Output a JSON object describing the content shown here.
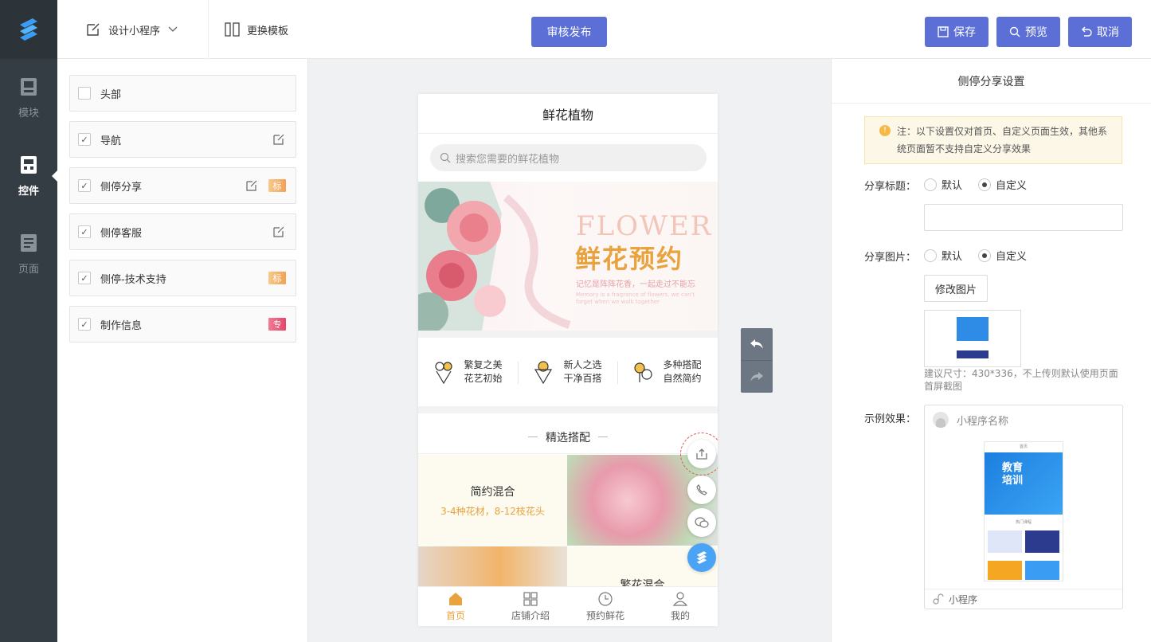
{
  "rail": {
    "items": [
      {
        "label": "模块",
        "icon": "module-icon"
      },
      {
        "label": "控件",
        "icon": "widget-icon",
        "active": true
      },
      {
        "label": "页面",
        "icon": "page-icon"
      }
    ]
  },
  "topbar": {
    "design_label": "设计小程序",
    "template_label": "更换模板",
    "publish_label": "审核发布",
    "save_label": "保存",
    "preview_label": "预览",
    "cancel_label": "取消"
  },
  "components": [
    {
      "label": "头部",
      "checked": false,
      "edit": false,
      "badge": ""
    },
    {
      "label": "导航",
      "checked": true,
      "edit": true,
      "badge": ""
    },
    {
      "label": "侧停分享",
      "checked": true,
      "edit": true,
      "badge": "标"
    },
    {
      "label": "侧停客服",
      "checked": true,
      "edit": true,
      "badge": ""
    },
    {
      "label": "侧停-技术支持",
      "checked": true,
      "edit": false,
      "badge": "标"
    },
    {
      "label": "制作信息",
      "checked": true,
      "edit": false,
      "badge": "专"
    }
  ],
  "phone": {
    "title": "鲜花植物",
    "search_placeholder": "搜索您需要的鲜花植物",
    "banner": {
      "en": "FLOWER",
      "cn": "鲜花预约",
      "sub": "记忆是阵阵花香，一起走过不能忘",
      "sub2": "Memory is a fragrance of flowers, we can't forget when we walk together"
    },
    "features": [
      {
        "line1": "繁复之美",
        "line2": "花艺初始"
      },
      {
        "line1": "新人之选",
        "line2": "干净百搭"
      },
      {
        "line1": "多种搭配",
        "line2": "自然简约"
      }
    ],
    "section_title": "精选搭配",
    "combo1": {
      "name": "简约混合",
      "desc": "3-4种花材，8-12枝花头"
    },
    "combo2": {
      "name": "繁花混合"
    },
    "tabs": [
      {
        "label": "首页",
        "icon": "home-icon",
        "active": true
      },
      {
        "label": "店铺介绍",
        "icon": "grid-icon"
      },
      {
        "label": "预约鲜花",
        "icon": "clock-icon"
      },
      {
        "label": "我的",
        "icon": "user-icon"
      }
    ]
  },
  "settings": {
    "title": "侧停分享设置",
    "notice_line1": "注：以下设置仅对首页、自定义页面生效，其他系",
    "notice_line2": "统页面暂不支持自定义分享效果",
    "share_title_label": "分享标题：",
    "share_image_label": "分享图片：",
    "option_default": "默认",
    "option_custom": "自定义",
    "title_value": "",
    "modify_image_label": "修改图片",
    "hint": "建议尺寸：430*336，不上传则默认使用页面首屏截图",
    "example_label": "示例效果：",
    "example_app_name": "小程序名称",
    "example_footer": "小程序",
    "example_screen_title": "首页",
    "example_banner_text": "教育培训",
    "example_row_label": "热门课程"
  },
  "colors": {
    "accent_blue": "#5b6fd6",
    "rail_bg": "#343c44",
    "orange": "#e8a23e",
    "pro_badge": "#e5456a"
  }
}
